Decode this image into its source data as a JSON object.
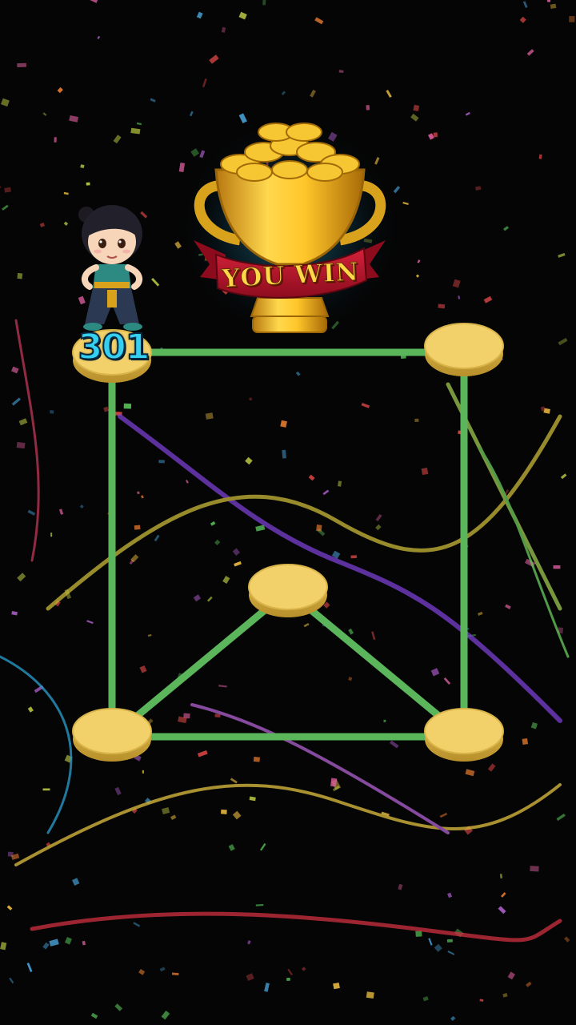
{
  "player": {
    "score": "301",
    "avatar": "girl-character"
  },
  "result": {
    "banner_text": "YOU WIN",
    "icon": "gold-trophy-with-coins"
  },
  "puzzle": {
    "line_color": "#5bb55a",
    "node_color": "#f2d16a",
    "nodes": [
      "top-left",
      "top-right",
      "center",
      "bottom-left",
      "bottom-right"
    ],
    "edges": [
      [
        "top-left",
        "top-right"
      ],
      [
        "top-left",
        "bottom-left"
      ],
      [
        "top-right",
        "bottom-right"
      ],
      [
        "bottom-left",
        "bottom-right"
      ],
      [
        "bottom-left",
        "center"
      ],
      [
        "center",
        "bottom-right"
      ]
    ]
  }
}
